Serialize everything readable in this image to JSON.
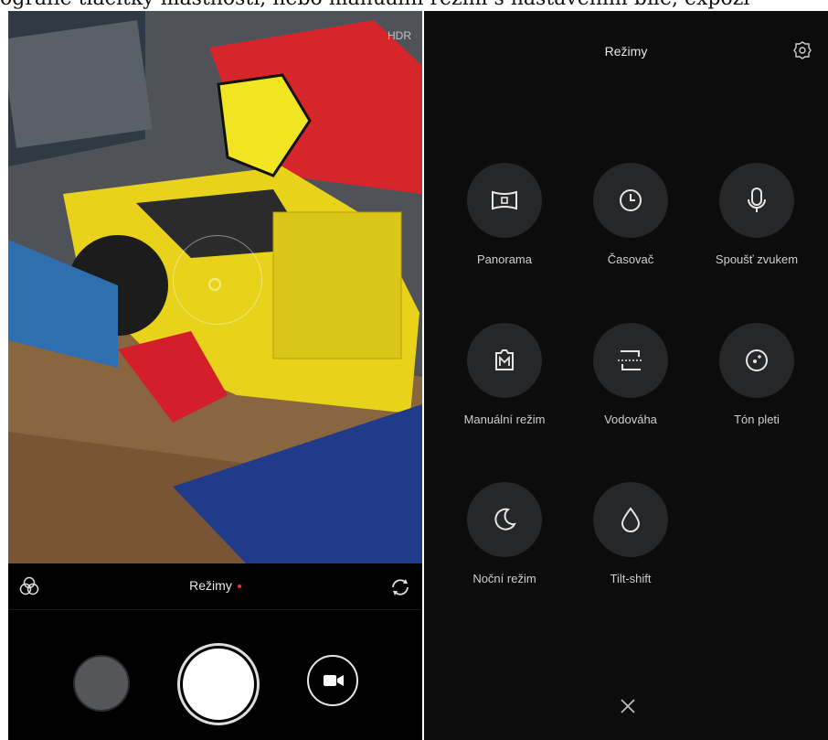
{
  "caption": "ografie tlačítky mastnosti, nebo manuální režim s nastavením bílé, expozi",
  "viewfinder": {
    "corner_text": "HDR"
  },
  "bottom_bar": {
    "modes_label": "Režimy"
  },
  "modes_panel": {
    "title": "Režimy",
    "items": [
      {
        "label": "Panorama",
        "icon": "panorama-icon"
      },
      {
        "label": "Časovač",
        "icon": "timer-icon"
      },
      {
        "label": "Spoušť zvukem",
        "icon": "microphone-icon"
      },
      {
        "label": "Manuální režim",
        "icon": "manual-icon"
      },
      {
        "label": "Vodováha",
        "icon": "level-icon"
      },
      {
        "label": "Tón pleti",
        "icon": "skin-tone-icon"
      },
      {
        "label": "Noční režim",
        "icon": "moon-icon"
      },
      {
        "label": "Tilt-shift",
        "icon": "drop-icon"
      }
    ]
  },
  "colors": {
    "accent_dot": "#ee3333",
    "panel_bg": "#0c0c0d",
    "circle_bg": "#262729"
  }
}
